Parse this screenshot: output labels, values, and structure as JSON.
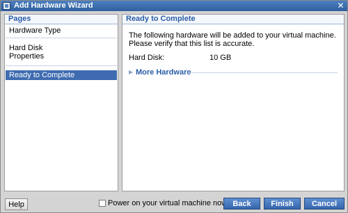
{
  "window": {
    "title": "Add Hardware Wizard",
    "close_glyph": "✕",
    "icon": "wizard-window-icon"
  },
  "pages": {
    "header": "Pages",
    "items": [
      {
        "label": "Hardware Type"
      },
      {
        "label": "Hard Disk"
      },
      {
        "label": "Properties"
      },
      {
        "label": "Ready to Complete",
        "selected": true
      }
    ]
  },
  "content": {
    "header": "Ready to Complete",
    "description": "The following hardware will be added to your virtual machine. Please verify that this list is accurate.",
    "items": [
      {
        "label": "Hard Disk:",
        "value": "10 GB"
      }
    ],
    "more_hardware": "More Hardware",
    "more_icon": "expand-triangle-icon"
  },
  "footer": {
    "help": "Help",
    "power_on_label": "Power on your virtual machine now",
    "power_on_checked": false,
    "back": "Back",
    "finish": "Finish",
    "cancel": "Cancel"
  },
  "colors": {
    "title_bar": "#2f5f9e",
    "accent_text": "#2a5da8",
    "selected_bg": "#3f6cb0",
    "button_blue": "#3566ad"
  }
}
